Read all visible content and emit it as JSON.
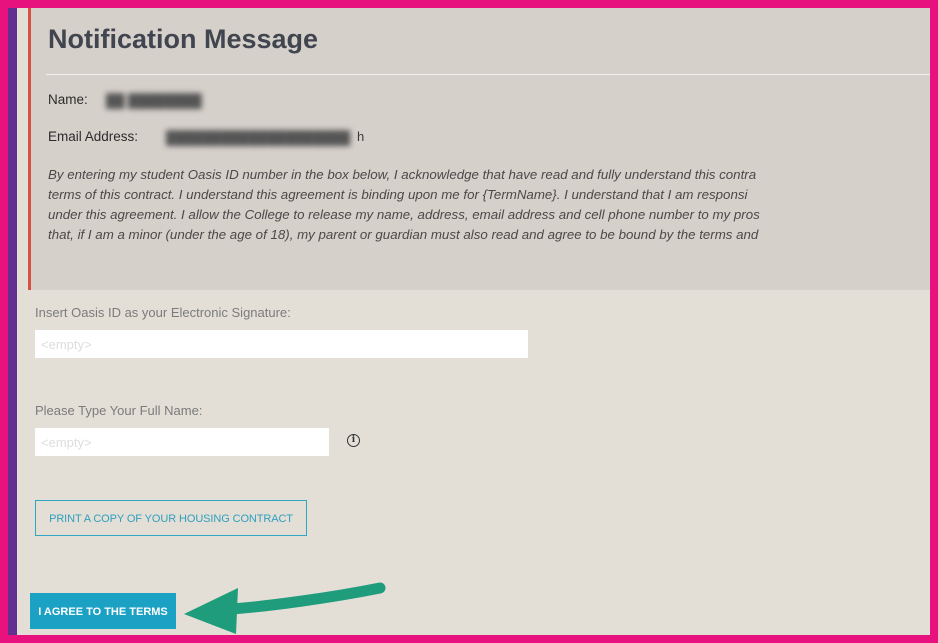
{
  "notification": {
    "title": "Notification Message",
    "name_label": "Name:",
    "name_value": "██ ████████",
    "email_label": "Email Address:",
    "email_value": "████████████████████",
    "email_visible_tail": "h",
    "disclaimer_lines": [
      "By entering my student Oasis ID number in the box below, I acknowledge that have read and fully understand this contra",
      "terms of this contract. I understand this agreement is binding upon me for {TermName}. I understand that I am responsi",
      "under this agreement. I allow the College to release my name, address, email address and cell phone number to my pros",
      "that, if I am a minor (under the age of 18), my parent or guardian must also read and agree to be bound by the terms and"
    ]
  },
  "form": {
    "signature_label": "Insert Oasis ID as your Electronic Signature:",
    "signature_placeholder": "<empty>",
    "fullname_label": "Please Type Your Full Name:",
    "fullname_placeholder": "<empty>",
    "info_icon_glyph": "i",
    "print_button_label": "PRINT A COPY OF YOUR HOUSING CONTRACT",
    "agree_button_label": "I AGREE TO THE TERMS"
  },
  "colors": {
    "outer_border": "#e8127f",
    "left_bar": "#62318f",
    "accent_red": "#d45143",
    "button_blue": "#1aa1c3",
    "arrow_green": "#1e9c7c"
  },
  "icons": {
    "info": "info-circle-icon",
    "annotation_arrow": "arrow-left-icon"
  }
}
